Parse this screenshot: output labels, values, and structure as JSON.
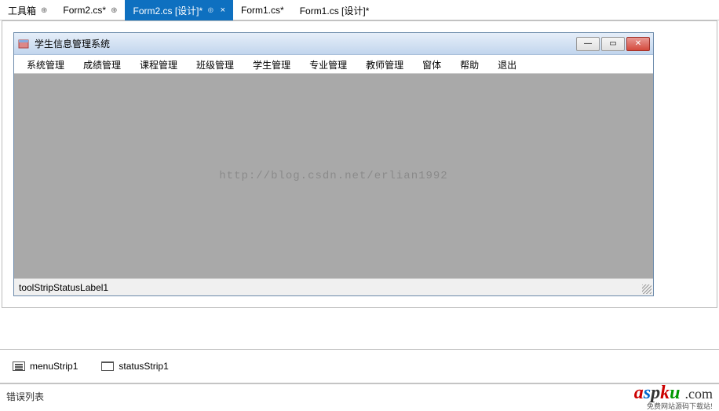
{
  "tabs": [
    {
      "label": "工具箱",
      "pin": "⊕",
      "active": false
    },
    {
      "label": "Form2.cs*",
      "pin": "",
      "active": false
    },
    {
      "label": "Form2.cs [设计]*",
      "pin": "⊕",
      "close": "×",
      "active": true
    },
    {
      "label": "Form1.cs*",
      "pin": "",
      "active": false
    },
    {
      "label": "Form1.cs [设计]*",
      "pin": "",
      "active": false
    }
  ],
  "winform": {
    "title": "学生信息管理系统",
    "menu": [
      "系统管理",
      "成绩管理",
      "课程管理",
      "班级管理",
      "学生管理",
      "专业管理",
      "教师管理",
      "窗体",
      "帮助",
      "退出"
    ],
    "watermark": "http://blog.csdn.net/erlian1992",
    "statusLabel": "toolStripStatusLabel1"
  },
  "tray": [
    {
      "name": "menuStrip1",
      "iconType": "menu"
    },
    {
      "name": "statusStrip1",
      "iconType": "status"
    }
  ],
  "errorList": "错误列表",
  "logo": {
    "main": "aspku",
    "suffix": ".com",
    "sub": "免费网站源码下载站!"
  }
}
